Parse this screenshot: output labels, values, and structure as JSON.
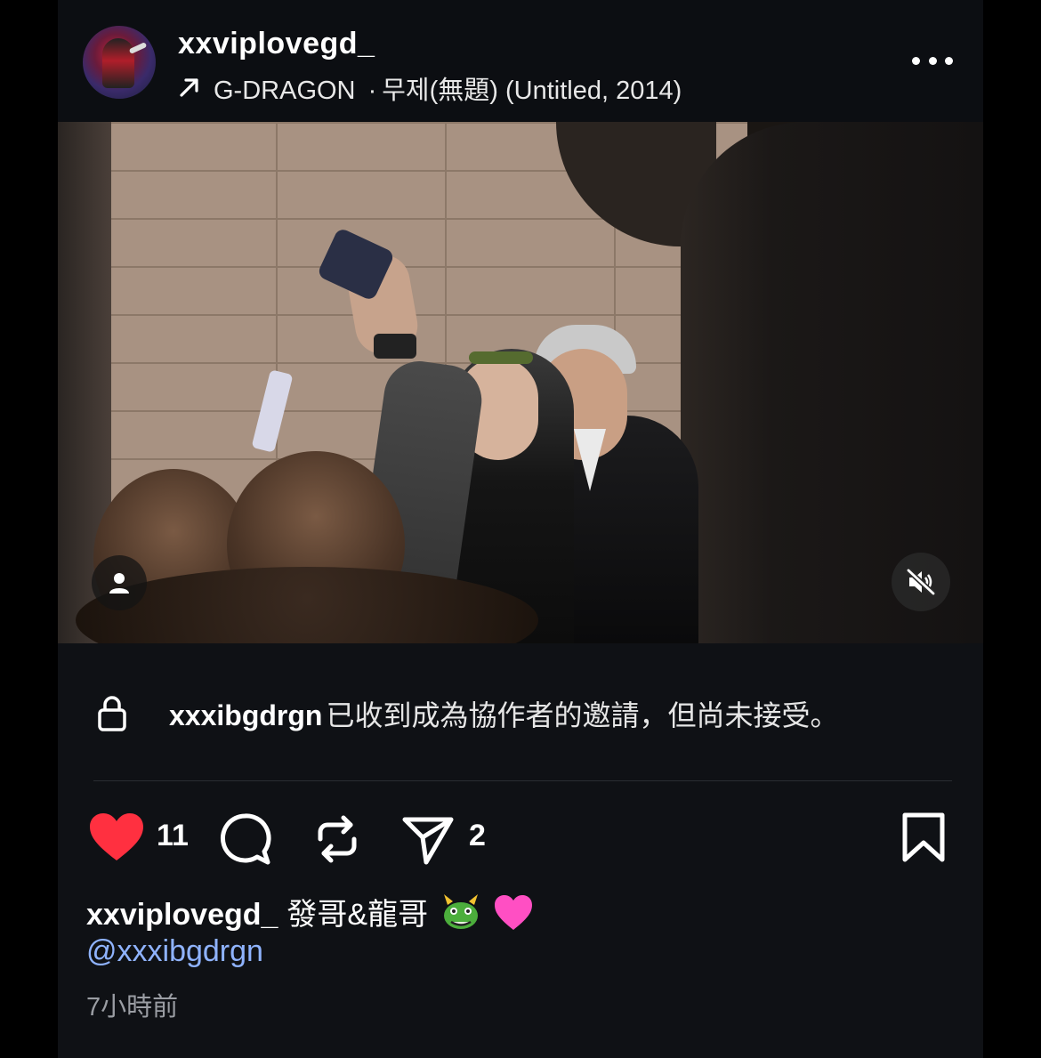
{
  "post": {
    "username": "xxviplovegd_",
    "song_artist": "G-DRAGON",
    "song_separator": "·",
    "song_title": "무제(無題) (Untitled, 2014)"
  },
  "collab": {
    "username": "xxxibgdrgn",
    "message": "已收到成為協作者的邀請，但尚未接受。"
  },
  "actions": {
    "likes": "11",
    "shares": "2"
  },
  "caption": {
    "username": "xxviplovegd_",
    "text": "發哥&龍哥",
    "mention": "@xxxibgdrgn",
    "time": "7小時前"
  },
  "colors": {
    "heart": "#ff3040",
    "mention": "#8fb3ff",
    "background": "#0f1115"
  },
  "icons": [
    "avatar",
    "repost-arrow-icon",
    "more-icon",
    "user-tag-icon",
    "mute-icon",
    "lock-icon",
    "heart-icon",
    "comment-icon",
    "repost-icon",
    "share-icon",
    "bookmark-icon",
    "dragon-emoji",
    "pink-heart-emoji"
  ]
}
